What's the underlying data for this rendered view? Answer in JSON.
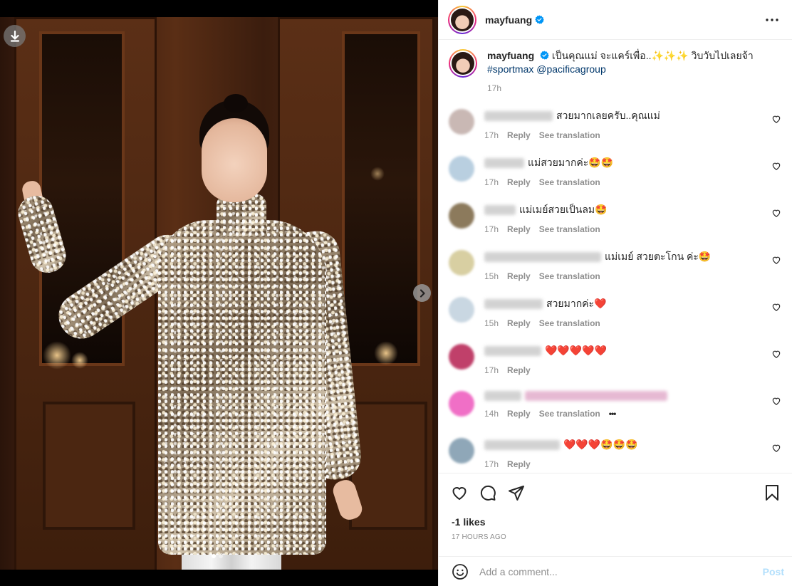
{
  "post": {
    "username": "mayfuang",
    "caption_text": "เป็นคุณแม่ จะแคร์เพื่อ..✨✨✨ วิบวับไปเลยจ้า",
    "caption_tags": "#sportmax @pacificagroup",
    "caption_time": "17h",
    "likes": "-1 likes",
    "date": "17 HOURS AGO"
  },
  "labels": {
    "reply": "Reply",
    "see_translation": "See translation",
    "more": "•••",
    "add_comment_placeholder": "Add a comment...",
    "post_button": "Post"
  },
  "comments": [
    {
      "text": "สวยมากเลยครับ..คุณแม่",
      "time": "17h",
      "translate": true,
      "avatar_color": "#c9b8b4"
    },
    {
      "text": "แม่สวยมากค่ะ🤩🤩",
      "time": "17h",
      "translate": true,
      "avatar_color": "#b9cfe0"
    },
    {
      "text": "แม่เมย์สวยเป็นลม🤩",
      "time": "17h",
      "translate": true,
      "avatar_color": "#8c7a5c"
    },
    {
      "text": "แม่เมย์ สวยตะโกน ค่ะ🤩",
      "time": "15h",
      "translate": true,
      "avatar_color": "#d8cfa2"
    },
    {
      "text": "สวยมากค่ะ❤️",
      "time": "15h",
      "translate": true,
      "avatar_color": "#c9d7e2"
    },
    {
      "text": "❤️❤️❤️❤️❤️",
      "time": "17h",
      "translate": false,
      "avatar_color": "#c0406a"
    },
    {
      "text": "",
      "time": "14h",
      "translate": true,
      "avatar_color": "#f06fc6"
    },
    {
      "text": "❤️❤️❤️🤩🤩🤩",
      "time": "17h",
      "translate": false,
      "avatar_color": "#8fa7b8"
    }
  ],
  "icons": {
    "verified": "verified-badge-icon",
    "more": "more-horizontal-icon",
    "like": "heart-icon",
    "comment": "comment-icon",
    "share": "send-icon",
    "save": "bookmark-icon",
    "emoji": "emoji-icon",
    "download": "download-icon",
    "next": "chevron-right-icon"
  },
  "colors": {
    "accent": "#0095f6",
    "tag": "#00376b",
    "post_disabled": "#b2dffc",
    "muted": "#8e8e8e"
  }
}
